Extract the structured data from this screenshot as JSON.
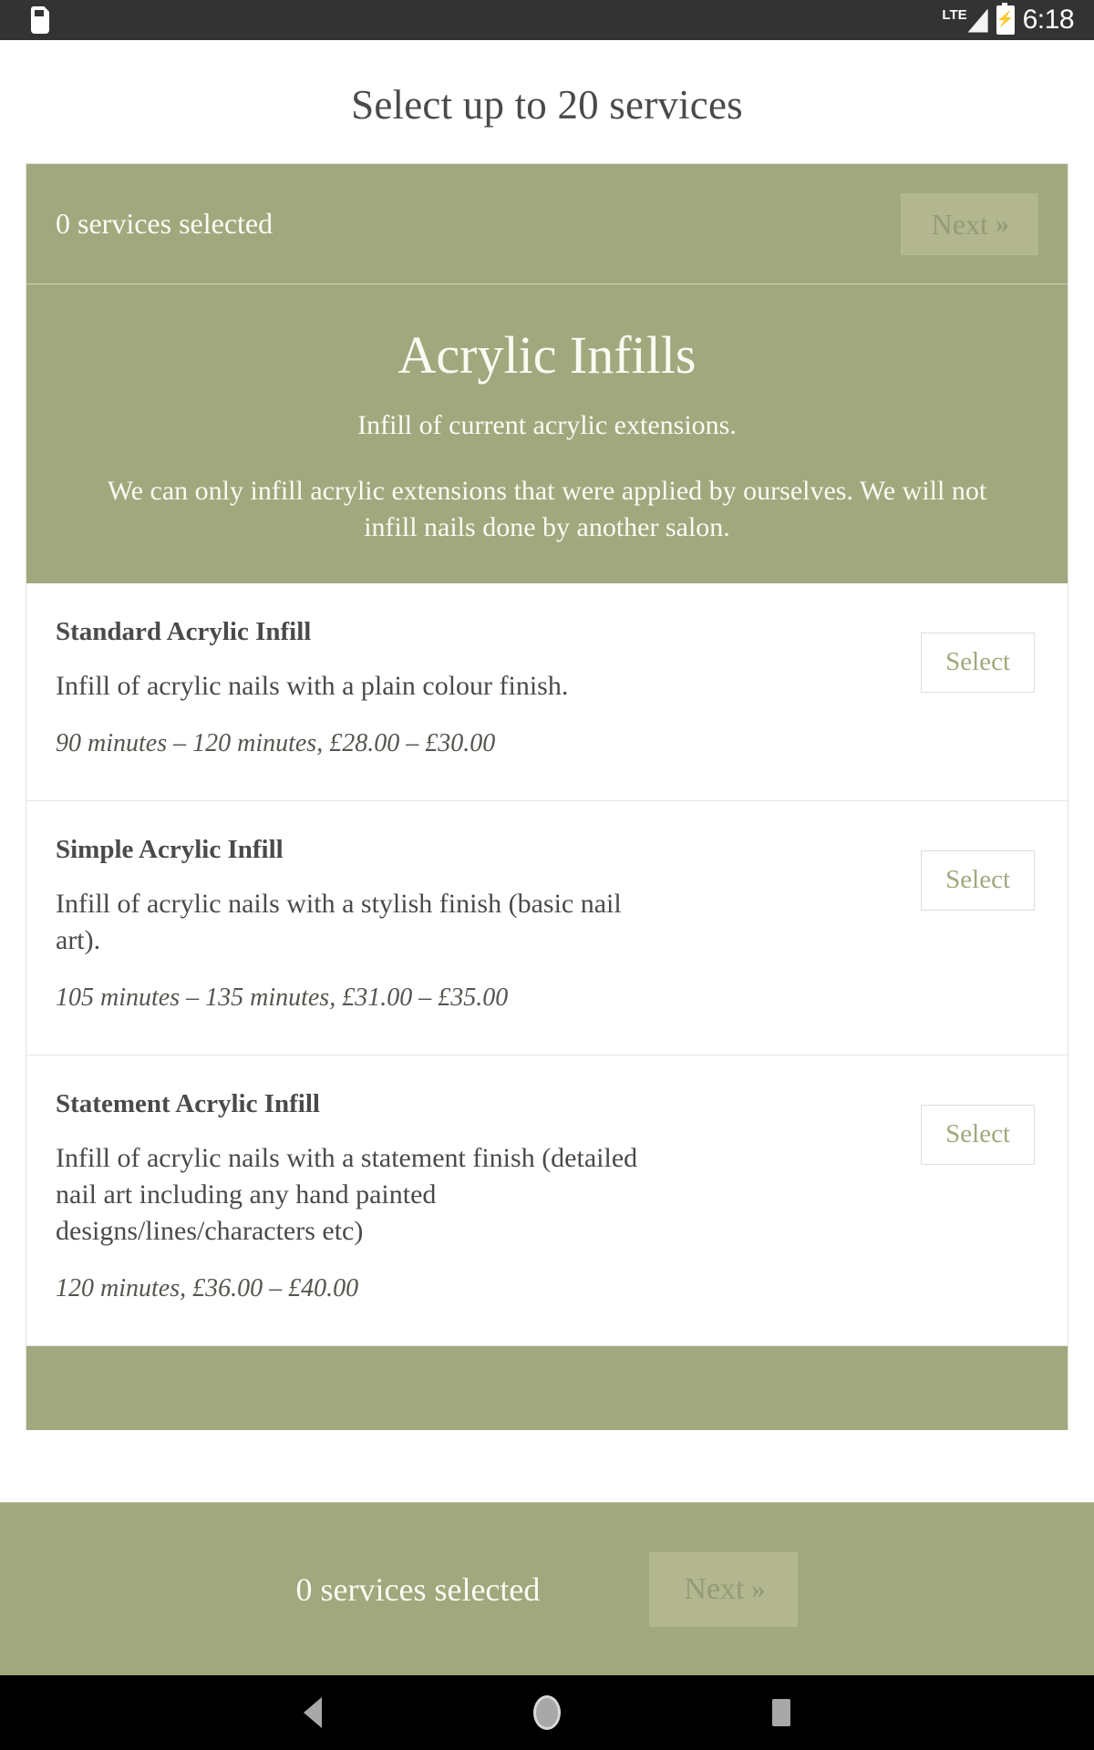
{
  "statusbar": {
    "sd_icon": "sd-card-icon",
    "network_label": "LTE",
    "signal_icon": "signal-bars-icon",
    "battery_icon": "battery-charging-icon",
    "time": "6:18"
  },
  "page_title": "Select up to 20 services",
  "summary": {
    "selected_text": "0 services selected",
    "next_label": "Next",
    "next_chevron": "»"
  },
  "section": {
    "title": "Acrylic Infills",
    "subtitle": "Infill of current acrylic extensions.",
    "description": "We can only infill acrylic extensions that were applied by ourselves. We will not infill nails done by another salon."
  },
  "services": [
    {
      "name": "Standard Acrylic Infill",
      "description": "Infill of acrylic nails with a plain colour finish.",
      "meta": "90 minutes – 120 minutes, £28.00 – £30.00",
      "select_label": "Select"
    },
    {
      "name": "Simple Acrylic Infill",
      "description": "Infill of acrylic nails with a stylish finish (basic nail art).",
      "meta": "105 minutes – 135 minutes, £31.00 – £35.00",
      "select_label": "Select"
    },
    {
      "name": "Statement Acrylic Infill",
      "description": "Infill of acrylic nails with a statement finish (detailed nail art including any hand painted designs/lines/characters etc)",
      "meta": "120 minutes, £36.00 – £40.00",
      "select_label": "Select"
    }
  ],
  "sticky_footer": {
    "selected_text": "0 services selected",
    "next_label": "Next",
    "next_chevron": "»"
  },
  "navbar": {
    "back": "back-icon",
    "home": "home-icon",
    "recents": "recents-icon"
  },
  "colors": {
    "brand_green": "#a2a87d",
    "brand_green_light": "#b2b790",
    "cream": "#fbfbf4",
    "text_dark": "#4a4a4a",
    "statusbar": "#333333"
  }
}
